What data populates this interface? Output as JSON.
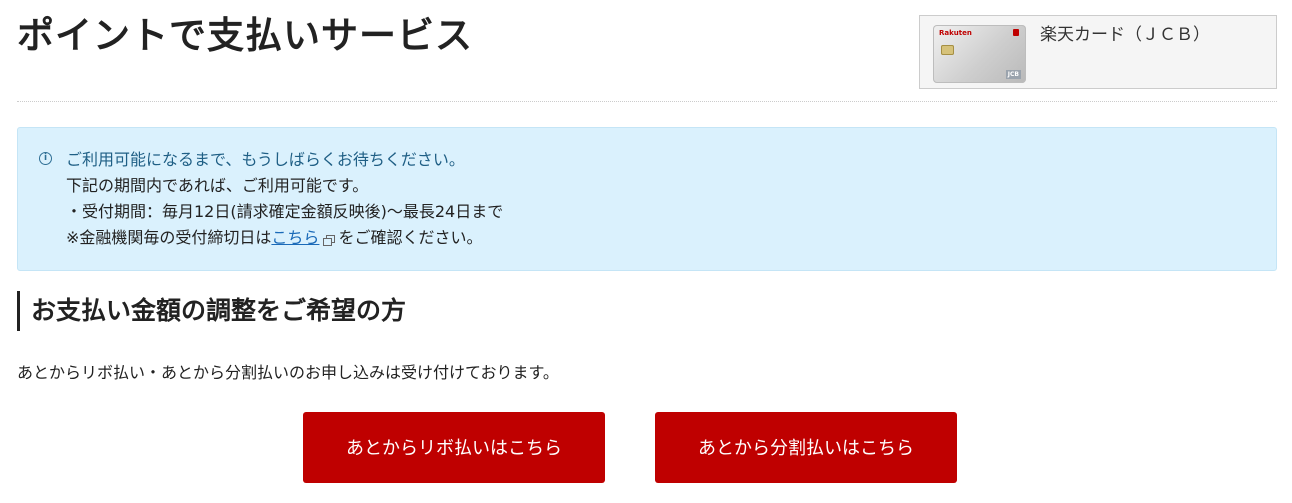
{
  "header": {
    "title": "ポイントで支払いサービス",
    "card": {
      "name": "楽天カード（ＪＣＢ）",
      "image_brand": "Rakuten",
      "image_network": "JCB"
    }
  },
  "notice": {
    "icon": "info-icon",
    "title": "ご利用可能になるまで、もうしばらくお待ちください。",
    "line1": "下記の期間内であれば、ご利用可能です。",
    "line2": "・受付期間：毎月12日(請求確定金額反映後)〜最長24日まで",
    "line3_prefix": "※金融機関毎の受付締切日は",
    "line3_link": "こちら",
    "line3_suffix": "をご確認ください。"
  },
  "section": {
    "title": "お支払い金額の調整をご希望の方",
    "description": "あとからリボ払い・あとから分割払いのお申し込みは受け付けております。"
  },
  "buttons": {
    "revolving": "あとからリボ払いはこちら",
    "installment": "あとから分割払いはこちら"
  },
  "colors": {
    "button": "#bf0000",
    "notice_bg": "#daf1fd",
    "link": "#1a6ab8"
  }
}
